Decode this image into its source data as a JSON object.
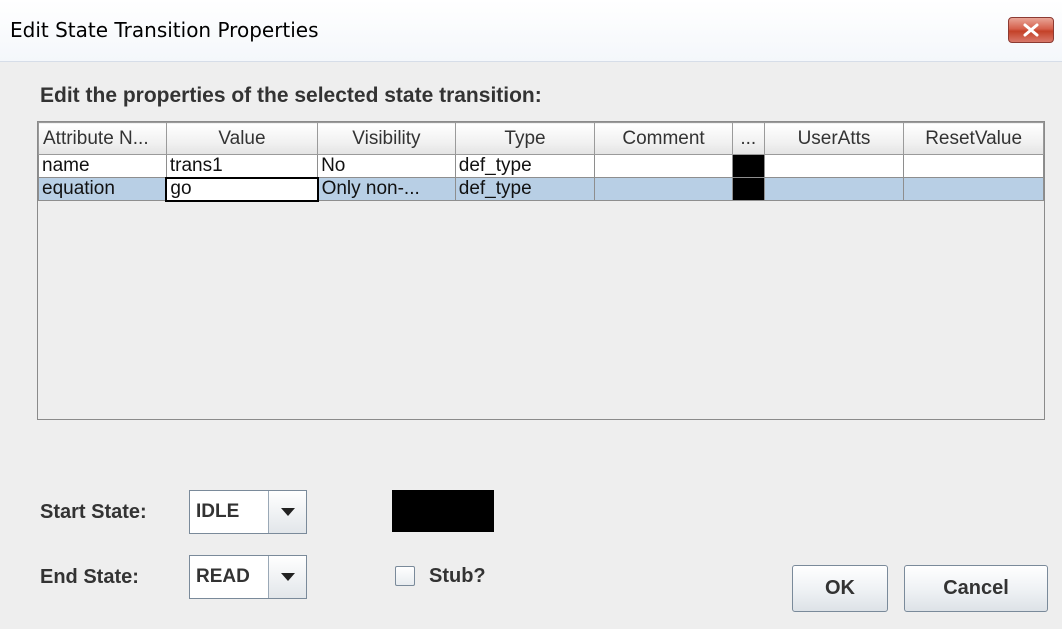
{
  "window": {
    "title": "Edit State Transition Properties",
    "close_icon": "close-x-icon"
  },
  "section_label": "Edit the properties of the selected state transition:",
  "table": {
    "columns": [
      "Attribute N...",
      "Value",
      "Visibility",
      "Type",
      "Comment",
      "...",
      "UserAtts",
      "ResetValue"
    ],
    "rows": [
      {
        "attribute": "name",
        "value": "trans1",
        "visibility": "No",
        "type": "def_type",
        "comment": "",
        "color": "#000000",
        "useratts": "",
        "resetvalue": ""
      },
      {
        "attribute": "equation",
        "value": "go",
        "visibility": "Only non-...",
        "type": "def_type",
        "comment": "",
        "color": "#000000",
        "useratts": "",
        "resetvalue": ""
      }
    ],
    "selected_row": 1,
    "selected_color": "#b8cfe5"
  },
  "form": {
    "start_state_label": "Start State:",
    "start_state_value": "IDLE",
    "end_state_label": "End State:",
    "end_state_value": "READ",
    "stub_label": "Stub?",
    "stub_checked": false,
    "transition_color": "#000000"
  },
  "buttons": {
    "ok": "OK",
    "cancel": "Cancel"
  }
}
